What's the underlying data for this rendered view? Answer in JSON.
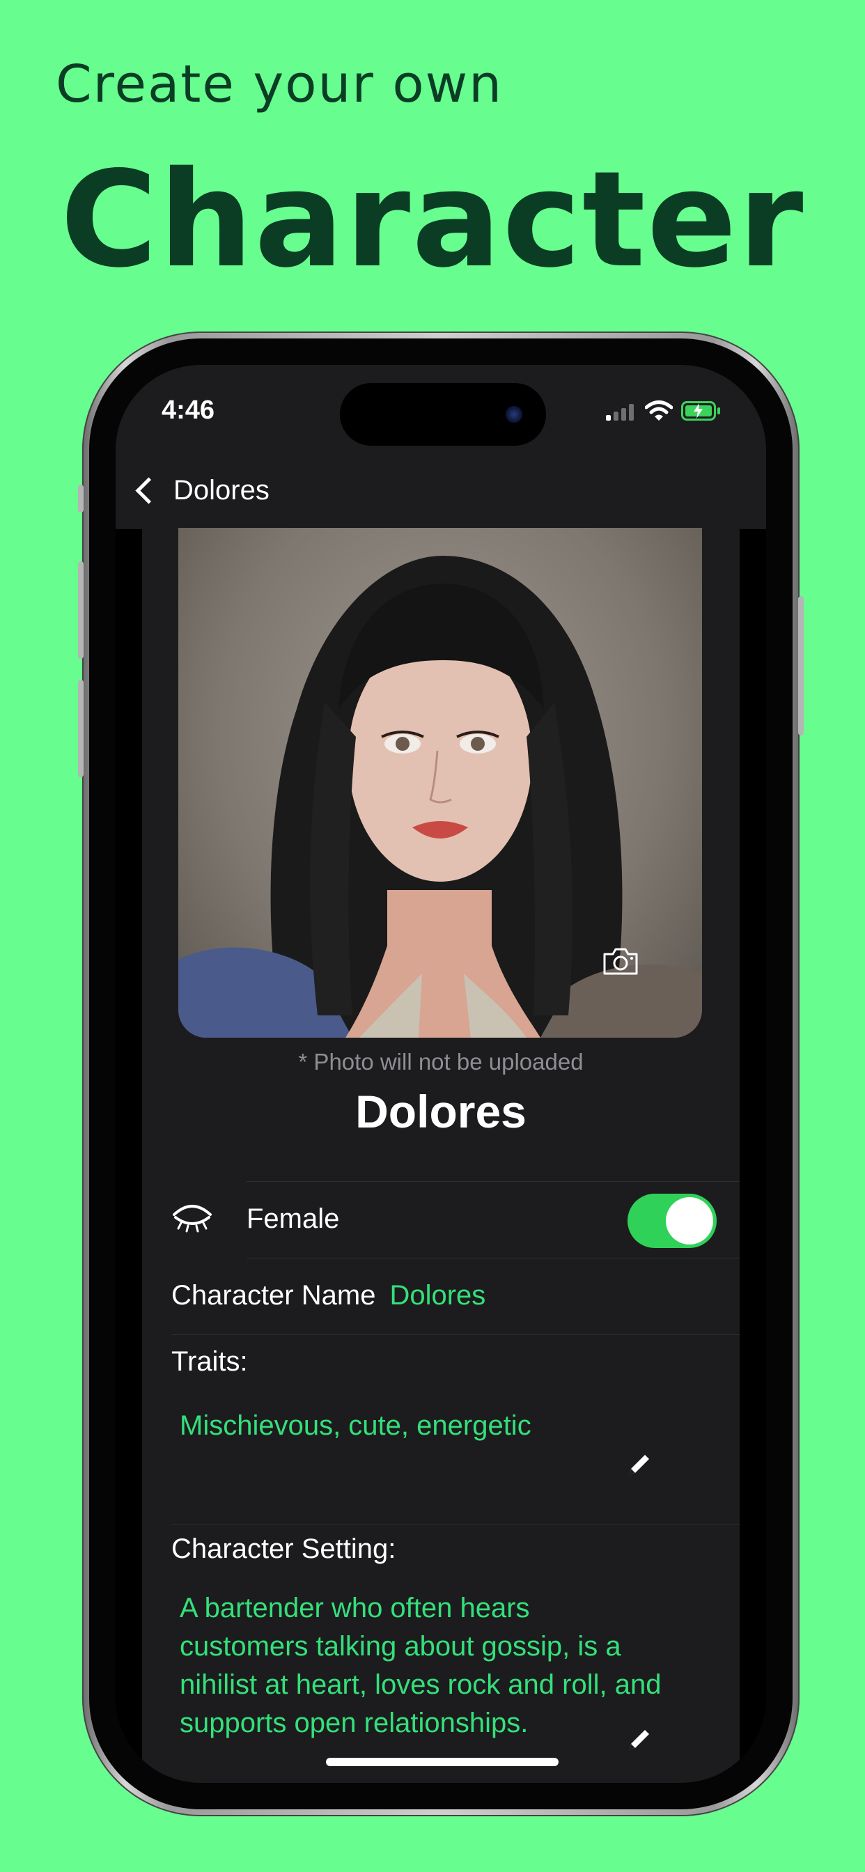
{
  "promo": {
    "subtitle": "Create your own",
    "title": "Character"
  },
  "status_bar": {
    "time": "4:46"
  },
  "nav": {
    "back_label": "Dolores"
  },
  "profile": {
    "photo_note": "* Photo will not be uploaded",
    "display_name": "Dolores"
  },
  "gender": {
    "label": "Female",
    "toggle_on": true
  },
  "character_name": {
    "label": "Character Name",
    "value": "Dolores"
  },
  "traits": {
    "label": "Traits:",
    "value": "Mischievous, cute, energetic"
  },
  "setting": {
    "label": "Character Setting:",
    "lines": [
      "A bartender who often hears",
      "customers talking about gossip, is a",
      "nihilist at heart, loves rock and roll, and",
      "supports open relationships."
    ]
  },
  "colors": {
    "background": "#67fd8f",
    "promo_text": "#0b3d25",
    "accent_text": "#34e07a",
    "toggle_on": "#30d158"
  }
}
